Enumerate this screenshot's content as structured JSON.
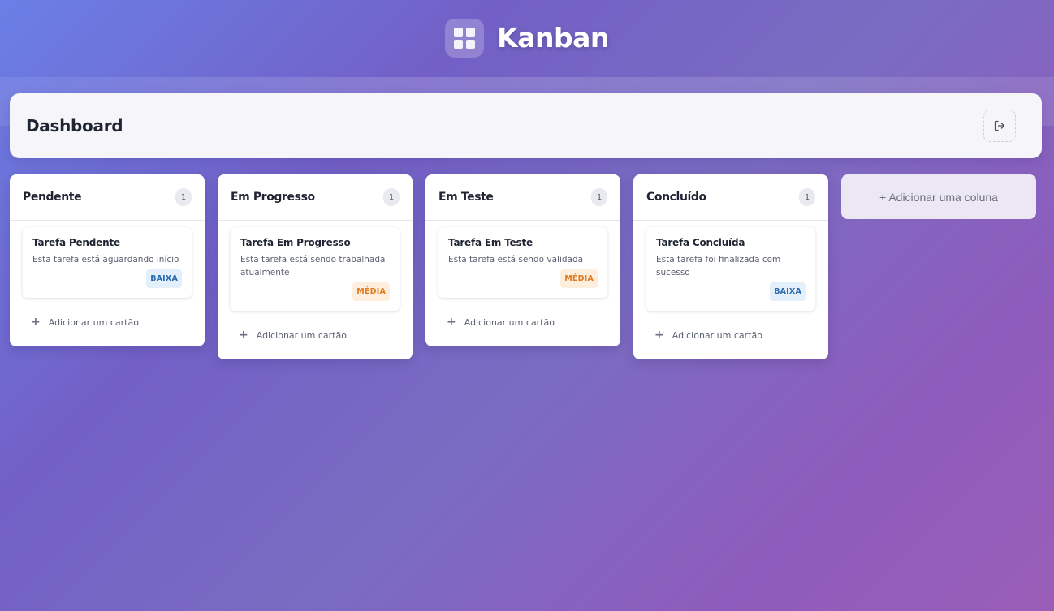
{
  "app": {
    "title": "Kanban",
    "icon": "grid-icon"
  },
  "header": {
    "title": "Dashboard",
    "logout_icon": "logout-icon"
  },
  "columns": [
    {
      "title": "Pendente",
      "count": "1",
      "cards": [
        {
          "title": "Tarefa Pendente",
          "description": "Esta tarefa está aguardando início",
          "priority": "BAIXA"
        }
      ],
      "add_label": "Adicionar um cartão"
    },
    {
      "title": "Em Progresso",
      "count": "1",
      "cards": [
        {
          "title": "Tarefa Em Progresso",
          "description": "Esta tarefa está sendo trabalhada atualmente",
          "priority": "MÉDIA"
        }
      ],
      "add_label": "Adicionar um cartão"
    },
    {
      "title": "Em Teste",
      "count": "1",
      "cards": [
        {
          "title": "Tarefa Em Teste",
          "description": "Esta tarefa está sendo validada",
          "priority": "MÉDIA"
        }
      ],
      "add_label": "Adicionar um cartão"
    },
    {
      "title": "Concluído",
      "count": "1",
      "cards": [
        {
          "title": "Tarefa Concluída",
          "description": "Esta tarefa foi finalizada com sucesso",
          "priority": "BAIXA"
        }
      ],
      "add_label": "Adicionar um cartão"
    }
  ],
  "add_column_label": "+ Adicionar uma coluna",
  "colors": {
    "baixa_bg": "#e3f0fc",
    "baixa_text": "#2a6bb3",
    "media_bg": "#fdeedd",
    "media_text": "#e07b1f"
  }
}
